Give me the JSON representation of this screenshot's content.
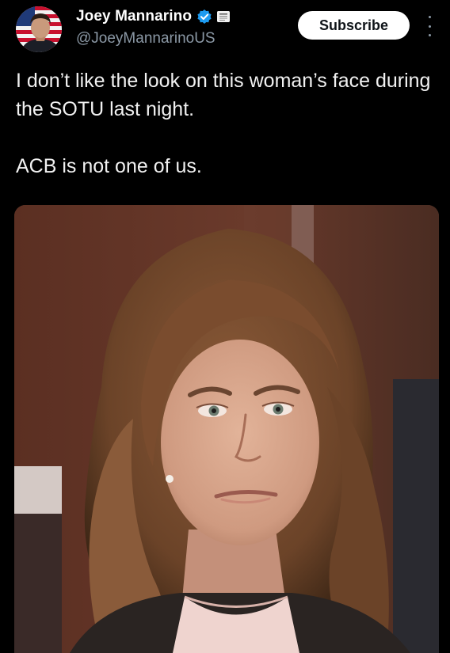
{
  "author": {
    "display_name": "Joey Mannarino",
    "handle": "@JoeyMannarinoUS"
  },
  "actions": {
    "subscribe_label": "Subscribe"
  },
  "tweet": {
    "paragraphs": [
      "I don’t like the look on this woman’s face during the SOTU last night.",
      "ACB is not one of us."
    ]
  },
  "icons": {
    "verified": "verified-badge-icon",
    "affiliation": "affiliation-badge-icon",
    "more": "more-options-icon"
  },
  "colors": {
    "background": "#000000",
    "verified_blue": "#1d9bf0",
    "handle_gray": "#8b98a5",
    "button_bg": "#ffffff"
  }
}
